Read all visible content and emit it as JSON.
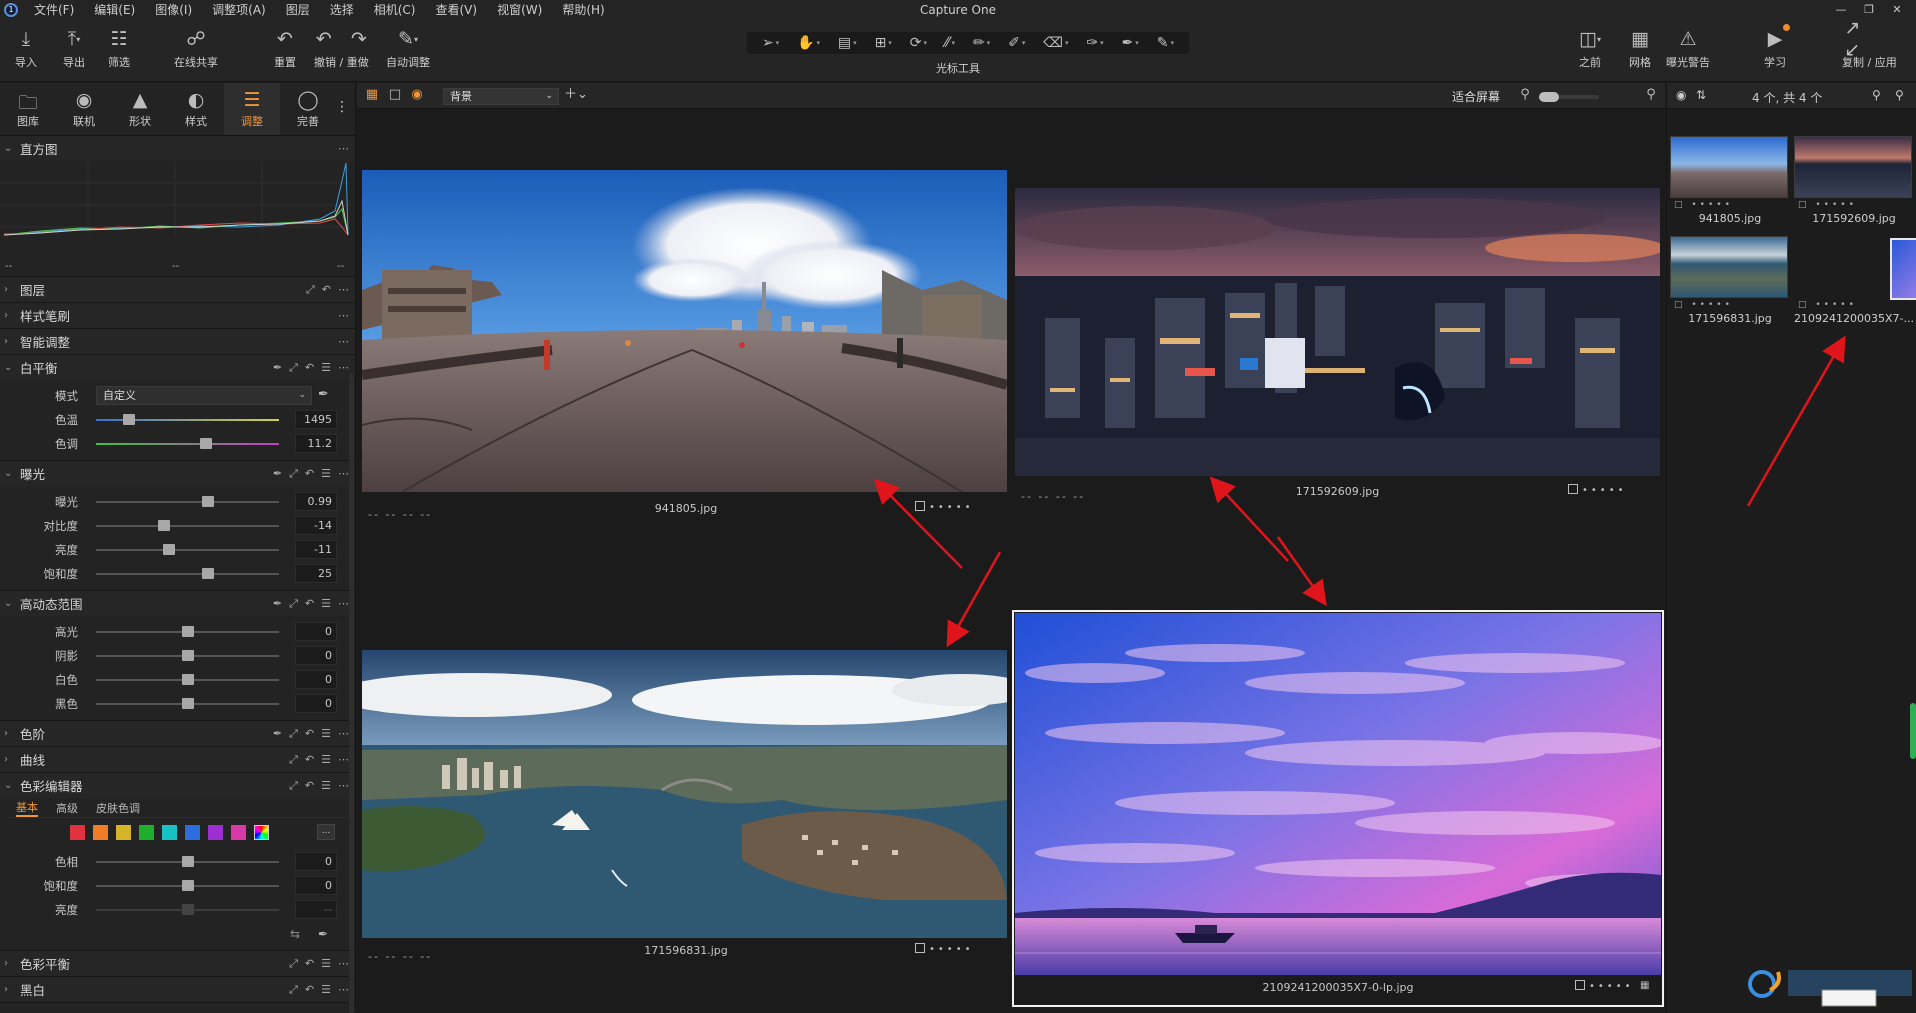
{
  "app": {
    "title": "Capture One",
    "logo_char": "1"
  },
  "menu": [
    "文件(F)",
    "编辑(E)",
    "图像(I)",
    "调整项(A)",
    "图层",
    "选择",
    "相机(C)",
    "查看(V)",
    "视窗(W)",
    "帮助(H)"
  ],
  "toolbar": {
    "import": "导入",
    "export": "导出",
    "filter": "筛选",
    "share": "在线共享",
    "reset": "重置",
    "undo_redo": "撤销 / 重做",
    "auto_adjust": "自动调整",
    "cursor_tools": "光标工具",
    "before": "之前",
    "grid": "网格",
    "exposure_warning": "曝光警告",
    "learn": "学习",
    "copy_apply": "复制 / 应用"
  },
  "left_tabs": [
    {
      "label": "图库",
      "icon": "folder-icon"
    },
    {
      "label": "联机",
      "icon": "camera-icon"
    },
    {
      "label": "形状",
      "icon": "shape-icon"
    },
    {
      "label": "样式",
      "icon": "style-icon"
    },
    {
      "label": "调整",
      "icon": "sliders-icon",
      "active": true
    },
    {
      "label": "完善",
      "icon": "refine-icon"
    }
  ],
  "sections": {
    "histogram": {
      "title": "直方图",
      "left": "--",
      "mid": "--",
      "right": "--"
    },
    "layers": {
      "title": "图层"
    },
    "style_brush": {
      "title": "样式笔刷"
    },
    "smart_adjust": {
      "title": "智能调整"
    },
    "white_balance": {
      "title": "白平衡",
      "mode_label": "模式",
      "mode_value": "自定义",
      "temp_label": "色温",
      "temp_value": "1495",
      "temp_pos": 0.18,
      "tint_label": "色调",
      "tint_value": "11.2",
      "tint_pos": 0.6
    },
    "exposure": {
      "title": "曝光",
      "rows": [
        {
          "label": "曝光",
          "value": "0.99",
          "pos": 0.61
        },
        {
          "label": "对比度",
          "value": "-14",
          "pos": 0.37
        },
        {
          "label": "亮度",
          "value": "-11",
          "pos": 0.4
        },
        {
          "label": "饱和度",
          "value": "25",
          "pos": 0.61
        }
      ]
    },
    "hdr": {
      "title": "高动态范围",
      "rows": [
        {
          "label": "高光",
          "value": "0",
          "pos": 0.5
        },
        {
          "label": "阴影",
          "value": "0",
          "pos": 0.5
        },
        {
          "label": "白色",
          "value": "0",
          "pos": 0.5
        },
        {
          "label": "黑色",
          "value": "0",
          "pos": 0.5
        }
      ]
    },
    "levels": {
      "title": "色阶"
    },
    "curves": {
      "title": "曲线"
    },
    "color_editor": {
      "title": "色彩编辑器",
      "tabs": [
        "基本",
        "高级",
        "皮肤色调"
      ],
      "swatch_colors": [
        "#e2323f",
        "#ef7d28",
        "#d6b42a",
        "#1eae2b",
        "#16c2c4",
        "#2c6ee0",
        "#9b2fd2",
        "#d53aa6"
      ],
      "more": "...",
      "rows": [
        {
          "label": "色相",
          "value": "0",
          "pos": 0.5
        },
        {
          "label": "饱和度",
          "value": "0",
          "pos": 0.5
        },
        {
          "label": "亮度",
          "value": "--",
          "pos": 0.5
        }
      ]
    },
    "color_balance": {
      "title": "色彩平衡"
    },
    "black_white": {
      "title": "黑白"
    }
  },
  "viewer_bar": {
    "layer_select": "背景",
    "fit_label": "适合屏幕"
  },
  "images": [
    {
      "name": "941805.jpg",
      "meta": "-- -- -- --"
    },
    {
      "name": "171592609.jpg",
      "meta": "-- -- -- --"
    },
    {
      "name": "171596831.jpg",
      "meta": "-- -- -- --"
    },
    {
      "name": "2109241200035X7-0-lp.jpg",
      "meta": "-- -- -- --"
    }
  ],
  "browser": {
    "count": "4 个, 共 4 个",
    "thumbs": [
      {
        "name": "941805.jpg"
      },
      {
        "name": "171592609.jpg"
      },
      {
        "name": "171596831.jpg"
      },
      {
        "name": "2109241200035X7-..."
      }
    ]
  },
  "colors": {
    "accent": "#f0963a",
    "annotation_arrow": "#e0151b",
    "scroll_green": "#2eae55"
  }
}
